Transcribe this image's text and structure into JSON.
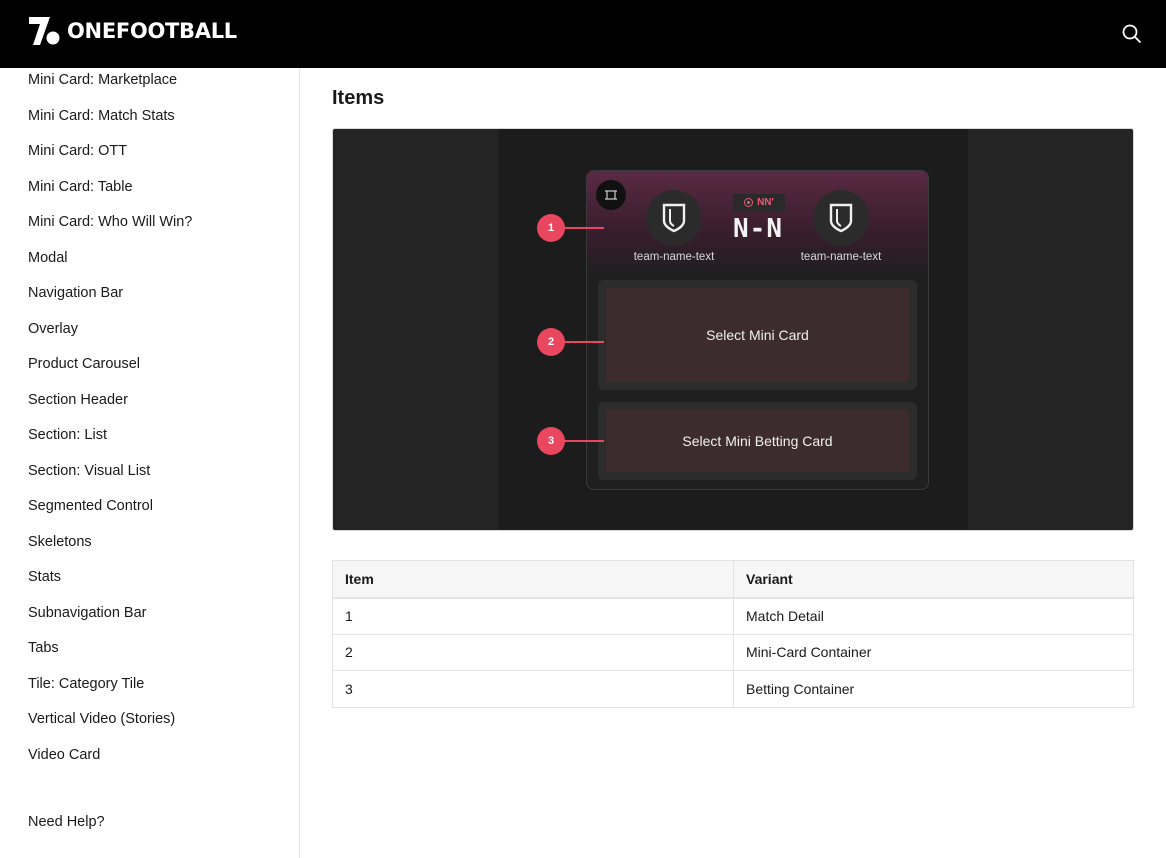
{
  "header": {
    "logo_text": "ONEFOOTBALL",
    "search_icon": "search-icon"
  },
  "sidebar": {
    "items": [
      {
        "label": "Mini Card: Marketplace"
      },
      {
        "label": "Mini Card: Match Stats"
      },
      {
        "label": "Mini Card: OTT"
      },
      {
        "label": "Mini Card: Table"
      },
      {
        "label": "Mini Card: Who Will Win?"
      },
      {
        "label": "Modal"
      },
      {
        "label": "Navigation Bar"
      },
      {
        "label": "Overlay"
      },
      {
        "label": "Product Carousel"
      },
      {
        "label": "Section Header"
      },
      {
        "label": "Section: List"
      },
      {
        "label": "Section: Visual List"
      },
      {
        "label": "Segmented Control"
      },
      {
        "label": "Skeletons"
      },
      {
        "label": "Stats"
      },
      {
        "label": "Subnavigation Bar"
      },
      {
        "label": "Tabs"
      },
      {
        "label": "Tile: Category Tile"
      },
      {
        "label": "Vertical Video (Stories)"
      },
      {
        "label": "Video Card"
      }
    ],
    "help_label": "Need Help?"
  },
  "main": {
    "section_title": "Items",
    "preview": {
      "live_label": "NN'",
      "score": "N-N",
      "home_team": "team-name-text",
      "away_team": "team-name-text",
      "slot_1_label": "Select Mini Card",
      "slot_2_label": "Select Mini Betting Card",
      "markers": [
        "1",
        "2",
        "3"
      ],
      "accent_color": "#e8475f"
    },
    "table": {
      "headers": [
        "Item",
        "Variant"
      ],
      "rows": [
        [
          "1",
          "Match Detail"
        ],
        [
          "2",
          "Mini-Card Container"
        ],
        [
          "3",
          "Betting Container"
        ]
      ]
    }
  }
}
